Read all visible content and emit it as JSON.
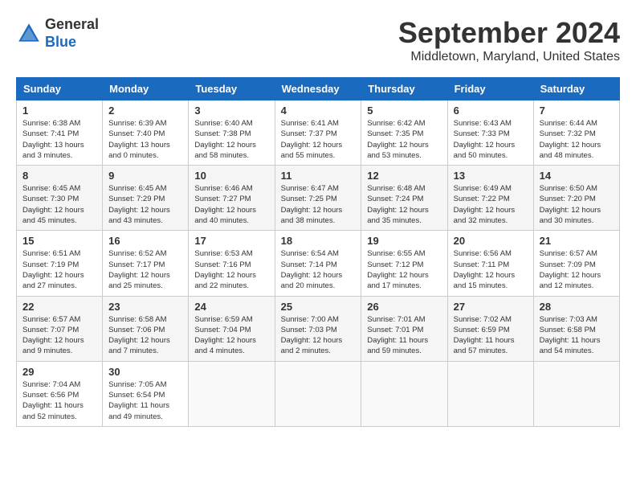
{
  "header": {
    "logo_general": "General",
    "logo_blue": "Blue",
    "month": "September 2024",
    "location": "Middletown, Maryland, United States"
  },
  "weekdays": [
    "Sunday",
    "Monday",
    "Tuesday",
    "Wednesday",
    "Thursday",
    "Friday",
    "Saturday"
  ],
  "weeks": [
    [
      {
        "day": "1",
        "sunrise": "6:38 AM",
        "sunset": "7:41 PM",
        "daylight": "13 hours and 3 minutes."
      },
      {
        "day": "2",
        "sunrise": "6:39 AM",
        "sunset": "7:40 PM",
        "daylight": "13 hours and 0 minutes."
      },
      {
        "day": "3",
        "sunrise": "6:40 AM",
        "sunset": "7:38 PM",
        "daylight": "12 hours and 58 minutes."
      },
      {
        "day": "4",
        "sunrise": "6:41 AM",
        "sunset": "7:37 PM",
        "daylight": "12 hours and 55 minutes."
      },
      {
        "day": "5",
        "sunrise": "6:42 AM",
        "sunset": "7:35 PM",
        "daylight": "12 hours and 53 minutes."
      },
      {
        "day": "6",
        "sunrise": "6:43 AM",
        "sunset": "7:33 PM",
        "daylight": "12 hours and 50 minutes."
      },
      {
        "day": "7",
        "sunrise": "6:44 AM",
        "sunset": "7:32 PM",
        "daylight": "12 hours and 48 minutes."
      }
    ],
    [
      {
        "day": "8",
        "sunrise": "6:45 AM",
        "sunset": "7:30 PM",
        "daylight": "12 hours and 45 minutes."
      },
      {
        "day": "9",
        "sunrise": "6:45 AM",
        "sunset": "7:29 PM",
        "daylight": "12 hours and 43 minutes."
      },
      {
        "day": "10",
        "sunrise": "6:46 AM",
        "sunset": "7:27 PM",
        "daylight": "12 hours and 40 minutes."
      },
      {
        "day": "11",
        "sunrise": "6:47 AM",
        "sunset": "7:25 PM",
        "daylight": "12 hours and 38 minutes."
      },
      {
        "day": "12",
        "sunrise": "6:48 AM",
        "sunset": "7:24 PM",
        "daylight": "12 hours and 35 minutes."
      },
      {
        "day": "13",
        "sunrise": "6:49 AM",
        "sunset": "7:22 PM",
        "daylight": "12 hours and 32 minutes."
      },
      {
        "day": "14",
        "sunrise": "6:50 AM",
        "sunset": "7:20 PM",
        "daylight": "12 hours and 30 minutes."
      }
    ],
    [
      {
        "day": "15",
        "sunrise": "6:51 AM",
        "sunset": "7:19 PM",
        "daylight": "12 hours and 27 minutes."
      },
      {
        "day": "16",
        "sunrise": "6:52 AM",
        "sunset": "7:17 PM",
        "daylight": "12 hours and 25 minutes."
      },
      {
        "day": "17",
        "sunrise": "6:53 AM",
        "sunset": "7:16 PM",
        "daylight": "12 hours and 22 minutes."
      },
      {
        "day": "18",
        "sunrise": "6:54 AM",
        "sunset": "7:14 PM",
        "daylight": "12 hours and 20 minutes."
      },
      {
        "day": "19",
        "sunrise": "6:55 AM",
        "sunset": "7:12 PM",
        "daylight": "12 hours and 17 minutes."
      },
      {
        "day": "20",
        "sunrise": "6:56 AM",
        "sunset": "7:11 PM",
        "daylight": "12 hours and 15 minutes."
      },
      {
        "day": "21",
        "sunrise": "6:57 AM",
        "sunset": "7:09 PM",
        "daylight": "12 hours and 12 minutes."
      }
    ],
    [
      {
        "day": "22",
        "sunrise": "6:57 AM",
        "sunset": "7:07 PM",
        "daylight": "12 hours and 9 minutes."
      },
      {
        "day": "23",
        "sunrise": "6:58 AM",
        "sunset": "7:06 PM",
        "daylight": "12 hours and 7 minutes."
      },
      {
        "day": "24",
        "sunrise": "6:59 AM",
        "sunset": "7:04 PM",
        "daylight": "12 hours and 4 minutes."
      },
      {
        "day": "25",
        "sunrise": "7:00 AM",
        "sunset": "7:03 PM",
        "daylight": "12 hours and 2 minutes."
      },
      {
        "day": "26",
        "sunrise": "7:01 AM",
        "sunset": "7:01 PM",
        "daylight": "11 hours and 59 minutes."
      },
      {
        "day": "27",
        "sunrise": "7:02 AM",
        "sunset": "6:59 PM",
        "daylight": "11 hours and 57 minutes."
      },
      {
        "day": "28",
        "sunrise": "7:03 AM",
        "sunset": "6:58 PM",
        "daylight": "11 hours and 54 minutes."
      }
    ],
    [
      {
        "day": "29",
        "sunrise": "7:04 AM",
        "sunset": "6:56 PM",
        "daylight": "11 hours and 52 minutes."
      },
      {
        "day": "30",
        "sunrise": "7:05 AM",
        "sunset": "6:54 PM",
        "daylight": "11 hours and 49 minutes."
      },
      null,
      null,
      null,
      null,
      null
    ]
  ]
}
